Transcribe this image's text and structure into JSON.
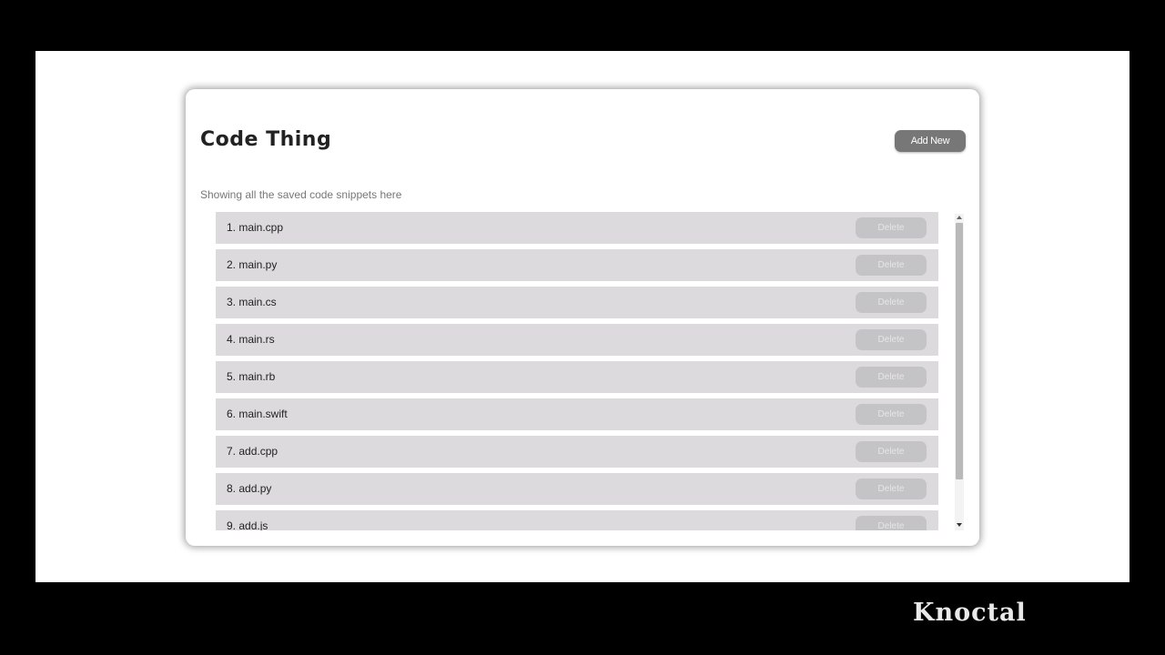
{
  "app": {
    "title": "Code Thing",
    "add_button_label": "Add New",
    "subtitle": "Showing all the saved code snippets here"
  },
  "snippets": [
    {
      "label": "1. main.cpp",
      "delete_label": "Delete"
    },
    {
      "label": "2. main.py",
      "delete_label": "Delete"
    },
    {
      "label": "3. main.cs",
      "delete_label": "Delete"
    },
    {
      "label": "4. main.rs",
      "delete_label": "Delete"
    },
    {
      "label": "5. main.rb",
      "delete_label": "Delete"
    },
    {
      "label": "6. main.swift",
      "delete_label": "Delete"
    },
    {
      "label": "7. add.cpp",
      "delete_label": "Delete"
    },
    {
      "label": "8. add.py",
      "delete_label": "Delete"
    },
    {
      "label": "9. add.js",
      "delete_label": "Delete"
    }
  ],
  "watermark": "Knoctal",
  "colors": {
    "row_background": "#dcdadc",
    "add_button": "#777777",
    "delete_button": "#c4c3c5",
    "letterbox": "#000000"
  },
  "icons": {
    "scroll_up": "scroll-up-arrow-icon",
    "scroll_down": "scroll-down-arrow-icon"
  }
}
